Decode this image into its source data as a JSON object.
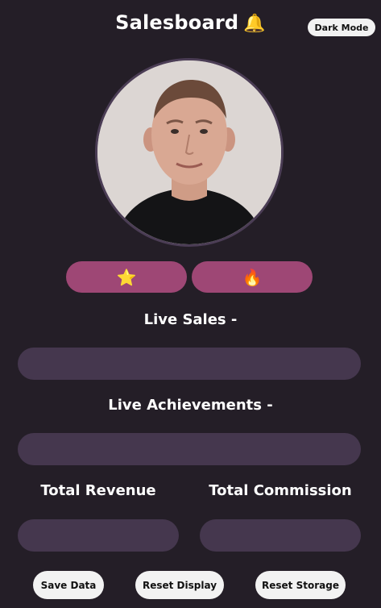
{
  "header": {
    "title": "Salesboard",
    "bell_icon": "🔔",
    "dark_mode_label": "Dark Mode"
  },
  "badges": {
    "star_icon": "⭐",
    "fire_icon": "🔥"
  },
  "sections": {
    "live_sales_label": "Live Sales -",
    "live_sales_value": "",
    "live_achievements_label": "Live Achievements -",
    "live_achievements_value": "",
    "total_revenue_label": "Total Revenue",
    "total_revenue_value": "",
    "total_commission_label": "Total Commission",
    "total_commission_value": ""
  },
  "actions": {
    "save_label": "Save Data",
    "reset_display_label": "Reset Display",
    "reset_storage_label": "Reset Storage"
  },
  "colors": {
    "background": "#241e27",
    "badge_button": "#9e4775",
    "display_bar": "#45374e",
    "light_button": "#f2f2f2"
  }
}
